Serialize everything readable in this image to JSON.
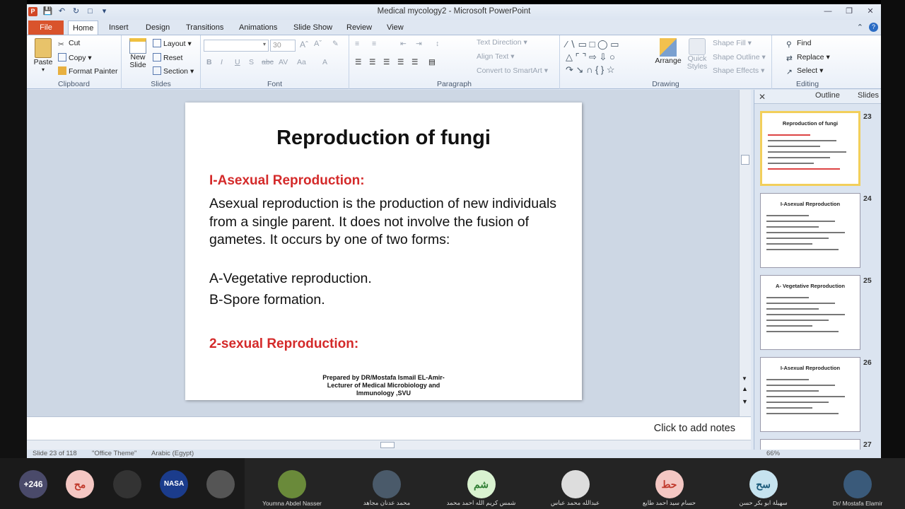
{
  "window": {
    "title": "Medical mycology2  -  Microsoft PowerPoint"
  },
  "tabs": {
    "file": "File",
    "items": [
      "Home",
      "Insert",
      "Design",
      "Transitions",
      "Animations",
      "Slide Show",
      "Review",
      "View"
    ],
    "active": "Home"
  },
  "ribbon": {
    "clipboard": {
      "label": "Clipboard",
      "paste": "Paste",
      "cut": "Cut",
      "copy": "Copy",
      "format_painter": "Format Painter"
    },
    "slides": {
      "label": "Slides",
      "new_slide": "New Slide",
      "layout": "Layout",
      "reset": "Reset",
      "section": "Section"
    },
    "font": {
      "label": "Font",
      "font_size": "30"
    },
    "paragraph": {
      "label": "Paragraph",
      "text_direction": "Text Direction",
      "align_text": "Align Text",
      "convert_smartart": "Convert to SmartArt"
    },
    "drawing": {
      "label": "Drawing",
      "arrange": "Arrange",
      "quick_styles": "Quick Styles",
      "shape_fill": "Shape Fill",
      "shape_outline": "Shape Outline",
      "shape_effects": "Shape Effects"
    },
    "editing": {
      "label": "Editing",
      "find": "Find",
      "replace": "Replace",
      "select": "Select"
    }
  },
  "slide": {
    "title": "Reproduction of fungi",
    "heading1": "I-Asexual Reproduction:",
    "body": "Asexual reproduction is the production of new individuals  from a single parent. It does not involve the fusion of gametes. It occurs by one of two forms:",
    "item_a": "A-Vegetative reproduction.",
    "item_b": "B-Spore formation.",
    "heading2": "2-sexual Reproduction:",
    "footer_line1": "Prepared by DR/Mostafa Ismail EL-Amir-",
    "footer_line2": "Lecturer of Medical Microbiology and",
    "footer_line3": "Immunology ,SVU"
  },
  "notes": {
    "placeholder": "Click to add notes"
  },
  "panel": {
    "tab_outline": "Outline",
    "tab_slides": "Slides",
    "thumbnails": [
      {
        "num": "23",
        "title": "Reproduction of fungi"
      },
      {
        "num": "24",
        "title": "I-Asexual Reproduction"
      },
      {
        "num": "25",
        "title": "A- Vegetative Reproduction"
      },
      {
        "num": "26",
        "title": "I-Asexual Reproduction"
      },
      {
        "num": "27",
        "title": ""
      }
    ]
  },
  "status": {
    "slide_info": "Slide 23 of 118",
    "theme": "\"Office Theme\"",
    "language": "Arabic (Egypt)",
    "zoom": "66%"
  },
  "participants": {
    "count": "+246",
    "people": [
      {
        "initials": "مح",
        "name": "",
        "color": "#f4c7c3"
      },
      {
        "initials": "",
        "name": "",
        "color": "#333333"
      },
      {
        "initials": "NASA",
        "name": "",
        "color": "#1b3c8c"
      },
      {
        "initials": "",
        "name": "",
        "color": "#555555"
      },
      {
        "initials": "",
        "name": "Youmna Abdel Nasser",
        "color": "#6a8a3a"
      },
      {
        "initials": "",
        "name": "محمد عدنان مجاهد",
        "color": "#4a5a6a"
      },
      {
        "initials": "شم",
        "name": "شمس كريم الله احمد محمد",
        "color": "#d9f2d0"
      },
      {
        "initials": "",
        "name": "عبدالله محمد عباس",
        "color": "#dddddd"
      },
      {
        "initials": "حط",
        "name": "حسام سيد احمد طايع",
        "color": "#f4c7c3"
      },
      {
        "initials": "سح",
        "name": "سهيلة ابو بكر حسن",
        "color": "#c6e3ef"
      },
      {
        "initials": "",
        "name": "Dr/ Mostafa Elamir",
        "color": "#3a5a7a"
      }
    ]
  }
}
